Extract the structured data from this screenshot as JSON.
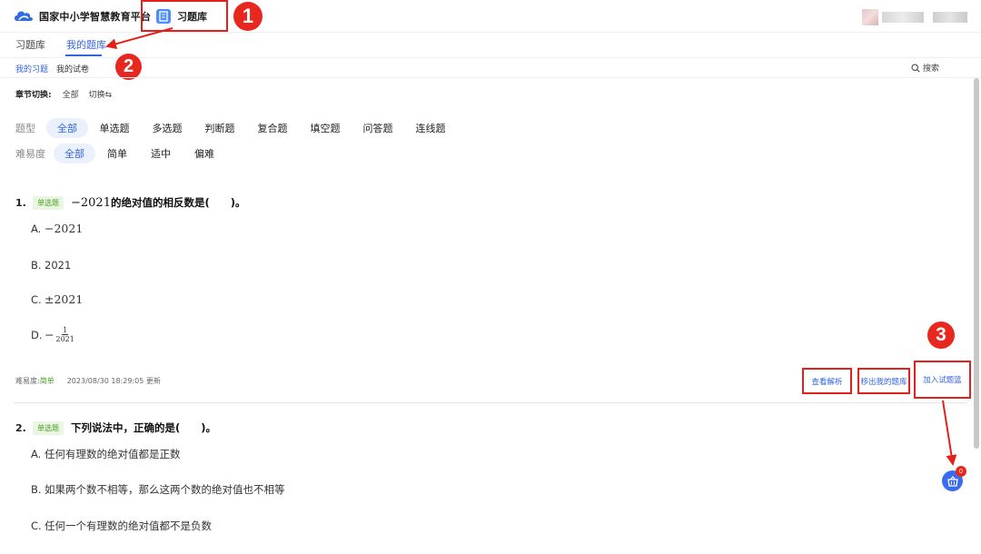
{
  "header": {
    "logo_text": "国家中小学智慧教育平台",
    "app_tab_label": "习题库"
  },
  "subnav": {
    "items": [
      "习题库",
      "我的题库"
    ],
    "active_index": 1
  },
  "minitabs": {
    "items": [
      "我的习题",
      "我的试卷"
    ],
    "active_index": 0,
    "search_label": "搜索"
  },
  "chapter": {
    "label": "章节切换:",
    "value": "全部",
    "switch_label": "切换⇆"
  },
  "filters": {
    "type_label": "题型",
    "types": [
      "全部",
      "单选题",
      "多选题",
      "判断题",
      "复合题",
      "填空题",
      "问答题",
      "连线题"
    ],
    "difficulty_label": "难易度",
    "difficulties": [
      "全部",
      "简单",
      "适中",
      "偏难"
    ]
  },
  "questions": [
    {
      "number": "1.",
      "badge": "单选题",
      "stem_math": "−2021",
      "stem_text": "的绝对值的相反数是(　　)。",
      "options": [
        {
          "letter": "A.",
          "text": "−2021"
        },
        {
          "letter": "B.",
          "text": "2021"
        },
        {
          "letter": "C.",
          "text": "±2021"
        },
        {
          "letter": "D.",
          "text": "−",
          "frac_num": "1",
          "frac_den": "2021"
        }
      ],
      "meta_label": "难易度:",
      "meta_difficulty": "简单",
      "meta_updated": "2023/08/30 18:29:05 更新",
      "actions": [
        "查看解析",
        "移出我的题库",
        "加入试题篮"
      ]
    },
    {
      "number": "2.",
      "badge": "单选题",
      "stem_text": "下列说法中，正确的是(　　)。",
      "options": [
        {
          "letter": "A.",
          "text": "任何有理数的绝对值都是正数"
        },
        {
          "letter": "B.",
          "text": "如果两个数不相等，那么这两个数的绝对值也不相等"
        },
        {
          "letter": "C.",
          "text": "任何一个有理数的绝对值都不是负数"
        }
      ]
    }
  ],
  "basket": {
    "count": "0"
  },
  "annotations": [
    "1",
    "2",
    "3"
  ],
  "colors": {
    "accent": "#3464e0",
    "annotation": "#e3201c",
    "easy": "#4ba12a"
  }
}
